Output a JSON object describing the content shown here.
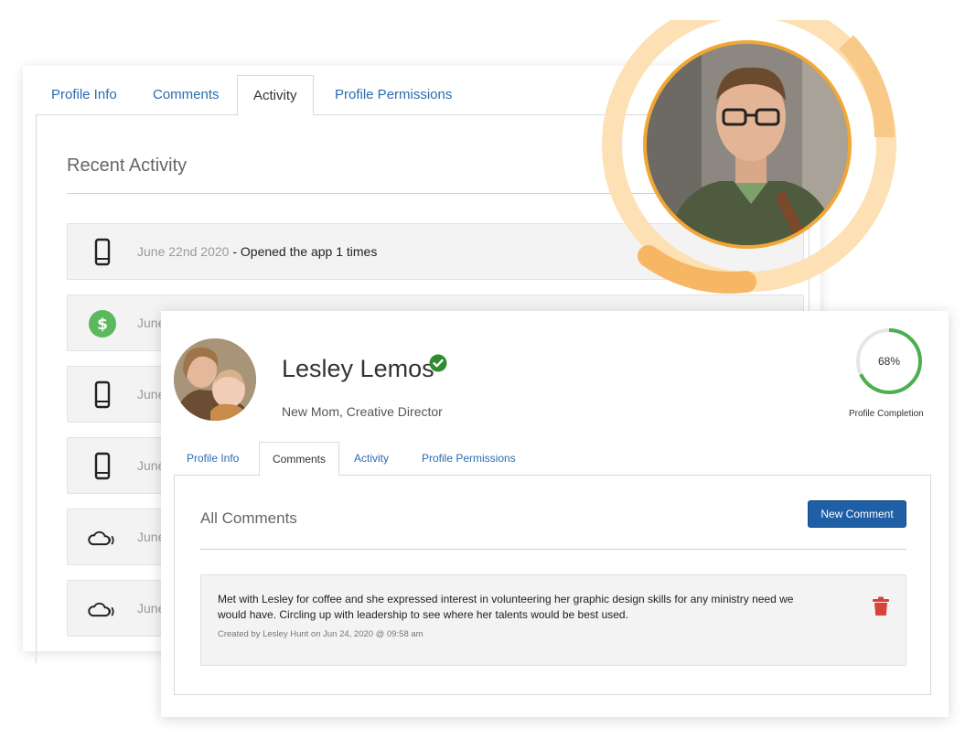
{
  "back": {
    "tabs": [
      {
        "label": "Profile Info",
        "active": false
      },
      {
        "label": "Comments",
        "active": false
      },
      {
        "label": "Activity",
        "active": true
      },
      {
        "label": "Profile Permissions",
        "active": false
      }
    ],
    "section_title": "Recent Activity",
    "activities": [
      {
        "icon": "phone-icon",
        "date": "June 22nd 2020",
        "separator": " - ",
        "text": "Opened the app 1 times"
      },
      {
        "icon": "dollar-icon",
        "date": "June"
      },
      {
        "icon": "phone-icon",
        "date": "June"
      },
      {
        "icon": "phone-icon",
        "date": "June"
      },
      {
        "icon": "cloud-broadcast-icon",
        "date": "June"
      },
      {
        "icon": "cloud-broadcast-icon",
        "date": "June"
      }
    ]
  },
  "profile": {
    "name": "Lesley Lemos",
    "role": "New Mom, Creative Director",
    "verified": true,
    "completion_percent": 68,
    "completion_text": "68%",
    "completion_label": "Profile Completion"
  },
  "front": {
    "tabs": [
      {
        "label": "Profile Info",
        "active": false
      },
      {
        "label": "Comments",
        "active": true
      },
      {
        "label": "Activity",
        "active": false
      },
      {
        "label": "Profile Permissions",
        "active": false
      }
    ],
    "section_title": "All Comments",
    "new_comment_label": "New Comment",
    "comments": [
      {
        "text": "Met with Lesley for coffee and she expressed interest in volunteering her graphic design skills for any ministry need we would have. Circling up with leadership to see where her talents would be best used.",
        "meta": "Created by Lesley Hunt on Jun 24, 2020 @ 09:58 am"
      }
    ]
  },
  "colors": {
    "accent_orange": "#f2a733",
    "ring_light": "#fde0b3",
    "link_blue": "#2a6cb0",
    "button_blue": "#1f5fa6",
    "progress_green": "#4caf50",
    "verified_green": "#2e8b2e",
    "delete_red": "#d9413b",
    "dollar_green": "#5cb85c"
  }
}
